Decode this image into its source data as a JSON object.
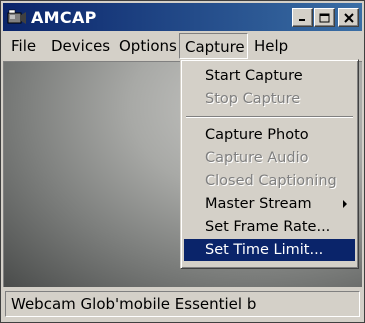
{
  "window": {
    "title": "AMCAP",
    "controls": {
      "minimize": "minimize",
      "maximize": "maximize",
      "close": "close"
    }
  },
  "menubar": {
    "items": [
      {
        "label": "File"
      },
      {
        "label": "Devices"
      },
      {
        "label": "Options"
      },
      {
        "label": "Capture"
      },
      {
        "label": "Help"
      }
    ]
  },
  "capture_menu": {
    "items": [
      {
        "label": "Start Capture",
        "enabled": true
      },
      {
        "label": "Stop Capture",
        "enabled": false
      },
      {
        "label": "Capture Photo",
        "enabled": true
      },
      {
        "label": "Capture Audio",
        "enabled": false
      },
      {
        "label": "Closed Captioning",
        "enabled": false
      },
      {
        "label": "Master Stream",
        "enabled": true,
        "submenu": true
      },
      {
        "label": "Set Frame Rate...",
        "enabled": true
      },
      {
        "label": "Set Time Limit...",
        "enabled": true,
        "selected": true
      }
    ]
  },
  "statusbar": {
    "text": "Webcam Glob'mobile Essentiel b"
  },
  "colors": {
    "titlebar_start": "#0a246a",
    "titlebar_end": "#3a6ea5",
    "selection": "#0a246a",
    "face": "#d4d0c8"
  }
}
